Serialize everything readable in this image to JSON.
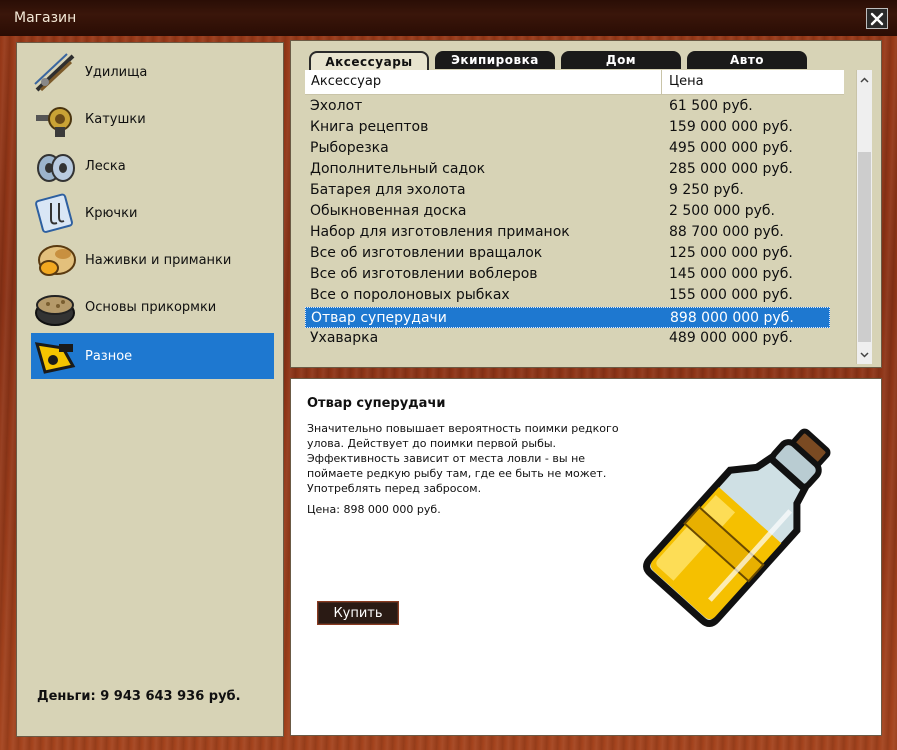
{
  "window": {
    "title": "Магазин",
    "close_icon": "close-icon"
  },
  "sidebar": {
    "items": [
      {
        "label": "Удилища",
        "icon": "fishing-rod-icon"
      },
      {
        "label": "Катушки",
        "icon": "reel-icon"
      },
      {
        "label": "Леска",
        "icon": "fishing-line-icon"
      },
      {
        "label": "Крючки",
        "icon": "hooks-icon"
      },
      {
        "label": "Наживки и приманки",
        "icon": "bait-icon"
      },
      {
        "label": "Основы прикормки",
        "icon": "groundbait-icon"
      },
      {
        "label": "Разное",
        "icon": "misc-icon"
      }
    ],
    "active_index": 6,
    "money": "Деньги: 9 943 643 936 руб."
  },
  "tabs": [
    {
      "label": "Аксессуары"
    },
    {
      "label": "Экипировка"
    },
    {
      "label": "Дом"
    },
    {
      "label": "Авто"
    }
  ],
  "active_tab": 0,
  "table": {
    "headers": {
      "item": "Аксессуар",
      "price": "Цена"
    },
    "rows": [
      {
        "name": "Эхолот",
        "price": "61 500 руб."
      },
      {
        "name": "Книга рецептов",
        "price": "159 000 000 руб."
      },
      {
        "name": "Рыборезка",
        "price": "495 000 000 руб."
      },
      {
        "name": "Дополнительный садок",
        "price": "285 000 000 руб."
      },
      {
        "name": "Батарея для эхолота",
        "price": "9 250 руб."
      },
      {
        "name": "Обыкновенная доска",
        "price": "2 500 000 руб."
      },
      {
        "name": "Набор для изготовления приманок",
        "price": "88 700 000 руб."
      },
      {
        "name": "Все об изготовлении вращалок",
        "price": "125 000 000 руб."
      },
      {
        "name": "Все об изготовлении воблеров",
        "price": "145 000 000 руб."
      },
      {
        "name": "Все о поролоновых рыбках",
        "price": "155 000 000 руб."
      },
      {
        "name": "Отвар суперудачи",
        "price": "898 000 000 руб."
      },
      {
        "name": "Ухаварка",
        "price": "489 000 000 руб."
      }
    ],
    "selected_index": 10
  },
  "detail": {
    "title": "Отвар суперудачи",
    "description": "Значительно повышает вероятность поимки редкого улова. Действует до поимки первой рыбы. Эффективность зависит от места ловли - вы не поймаете редкую рыбу там, где ее быть не может. Употреблять перед забросом.",
    "price": "Цена: 898 000 000 руб.",
    "buy_label": "Купить",
    "image": "potion-bottle-icon"
  },
  "colors": {
    "accent": "#1e78d0",
    "panel": "#d7d3b6",
    "wood": "#9a3a18"
  }
}
